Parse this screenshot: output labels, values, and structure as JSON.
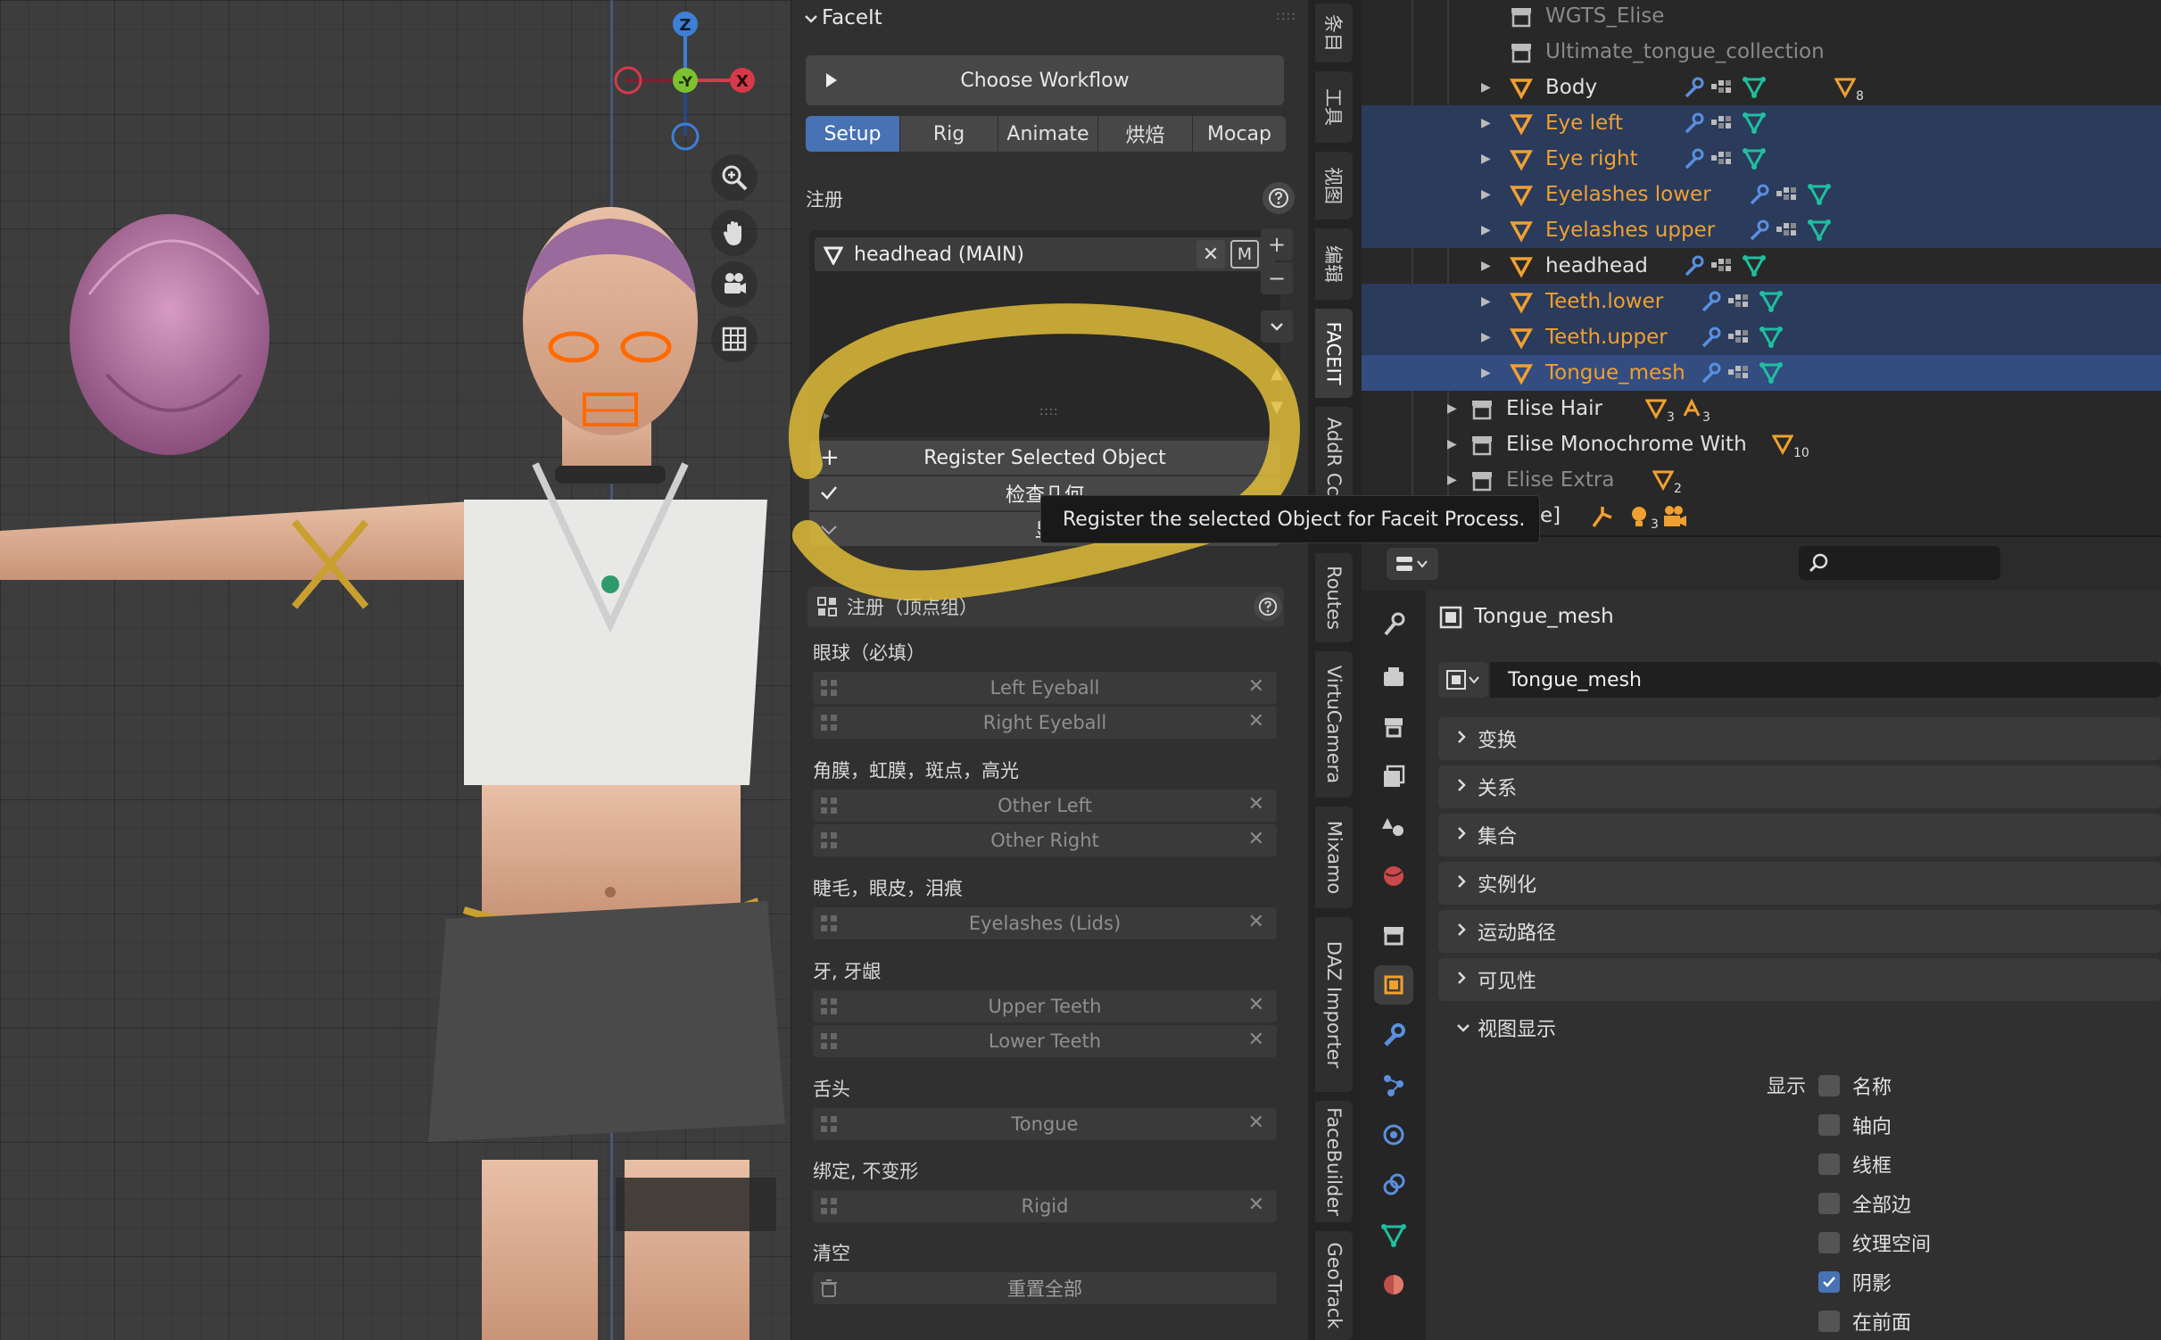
{
  "faceit": {
    "title": "FaceIt",
    "workflow_button": "Choose Workflow",
    "tabs": [
      {
        "label": "Setup",
        "active": true
      },
      {
        "label": "Rig",
        "active": false
      },
      {
        "label": "Animate",
        "active": false
      },
      {
        "label": "烘焙",
        "active": false
      },
      {
        "label": "Mocap",
        "active": false
      }
    ],
    "register_label": "注册",
    "registered_item": "headhead (MAIN)",
    "registered_item_badge": "M",
    "register_selected_btn": "Register Selected Object",
    "check_geometry_btn": "检查几何",
    "display_btn": "显",
    "vertex_groups_title": "注册（顶点组）",
    "groups": [
      {
        "label": "眼球（必填）",
        "fields": [
          "Left Eyeball",
          "Right Eyeball"
        ]
      },
      {
        "label": "角膜，虹膜，斑点，高光",
        "fields": [
          "Other Left",
          "Other Right"
        ]
      },
      {
        "label": "睫毛，眼皮，泪痕",
        "fields": [
          "Eyelashes (Lids)"
        ]
      },
      {
        "label": "牙, 牙龈",
        "fields": [
          "Upper Teeth",
          "Lower Teeth"
        ]
      },
      {
        "label": "舌头",
        "fields": [
          "Tongue"
        ]
      },
      {
        "label": "绑定, 不变形",
        "fields": [
          "Rigid"
        ]
      }
    ],
    "clear_label": "清空",
    "reset_all_btn": "重置全部"
  },
  "tooltip": "Register the selected Object for Faceit Process.",
  "side_tabs": [
    "条目",
    "工具",
    "视图",
    "编辑",
    "FACEIT",
    "AddR Cc",
    "Routes",
    "VirtuCamera",
    "Mixamo",
    "DAZ Importer",
    "FaceBuilder",
    "GeoTrack"
  ],
  "outliner": {
    "rows": [
      {
        "name": "WGTS_Elise",
        "kind": "collection",
        "style": "dim",
        "selected": "none"
      },
      {
        "name": "Ultimate_tongue_collection",
        "kind": "collection",
        "style": "dim",
        "selected": "none"
      },
      {
        "name": "Body",
        "kind": "mesh",
        "style": "normal",
        "selected": "none",
        "count": "8"
      },
      {
        "name": "Eye left",
        "kind": "mesh",
        "style": "orange",
        "selected": "selected"
      },
      {
        "name": "Eye right",
        "kind": "mesh",
        "style": "orange",
        "selected": "selected"
      },
      {
        "name": "Eyelashes lower",
        "kind": "mesh",
        "style": "orange",
        "selected": "selected"
      },
      {
        "name": "Eyelashes upper",
        "kind": "mesh",
        "style": "orange",
        "selected": "selected"
      },
      {
        "name": "headhead",
        "kind": "mesh",
        "style": "normal",
        "selected": "none"
      },
      {
        "name": "Teeth.lower",
        "kind": "mesh",
        "style": "orange",
        "selected": "selected"
      },
      {
        "name": "Teeth.upper",
        "kind": "mesh",
        "style": "orange",
        "selected": "selected"
      },
      {
        "name": "Tongue_mesh",
        "kind": "mesh",
        "style": "orange",
        "selected": "active"
      },
      {
        "name": "Elise Hair",
        "kind": "collection",
        "style": "normal",
        "selected": "none",
        "count": "3",
        "count2": "3"
      },
      {
        "name": "Elise Monochrome With",
        "kind": "collection",
        "style": "normal",
        "selected": "none",
        "count": "10"
      },
      {
        "name": "Elise Extra",
        "kind": "collection",
        "style": "dim",
        "selected": "none",
        "count": "2"
      }
    ],
    "last_row_text": "e]",
    "last_row_count": "3"
  },
  "properties": {
    "object_name": "Tongue_mesh",
    "name_field": "Tongue_mesh",
    "sections": [
      {
        "label": "变换",
        "open": false
      },
      {
        "label": "关系",
        "open": false
      },
      {
        "label": "集合",
        "open": false
      },
      {
        "label": "实例化",
        "open": false
      },
      {
        "label": "运动路径",
        "open": false
      },
      {
        "label": "可见性",
        "open": false
      },
      {
        "label": "视图显示",
        "open": true
      }
    ],
    "display_label": "显示",
    "checkboxes": [
      {
        "label": "名称",
        "checked": false
      },
      {
        "label": "轴向",
        "checked": false
      },
      {
        "label": "线框",
        "checked": false
      },
      {
        "label": "全部边",
        "checked": false
      },
      {
        "label": "纹理空间",
        "checked": false
      },
      {
        "label": "阴影",
        "checked": true
      },
      {
        "label": "在前面",
        "checked": false
      }
    ]
  },
  "gizmo": {
    "z_label": "Z",
    "y_label": "-Y",
    "x_label": "X"
  },
  "colors": {
    "accent_blue": "#4772b3",
    "outliner_orange": "#f0a030",
    "highlight_yellow": "#e6c23a",
    "x_red": "#d63a4a",
    "y_green": "#7cc230",
    "z_blue": "#3e7fd6"
  }
}
